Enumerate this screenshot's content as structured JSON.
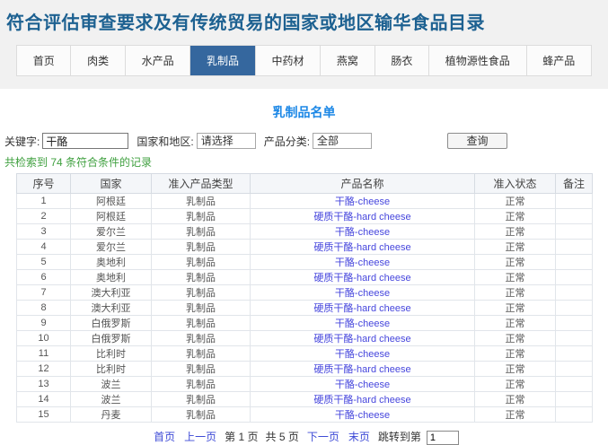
{
  "page": {
    "title": "符合评估审查要求及有传统贸易的国家或地区输华食品目录"
  },
  "nav": {
    "items": [
      {
        "label": "首页",
        "active": false
      },
      {
        "label": "肉类",
        "active": false
      },
      {
        "label": "水产品",
        "active": false
      },
      {
        "label": "乳制品",
        "active": true
      },
      {
        "label": "中药材",
        "active": false
      },
      {
        "label": "燕窝",
        "active": false
      },
      {
        "label": "肠衣",
        "active": false
      },
      {
        "label": "植物源性食品",
        "active": false
      },
      {
        "label": "蜂产品",
        "active": false
      }
    ]
  },
  "section": {
    "title": "乳制品名单"
  },
  "search": {
    "keyword_label": "关键字:",
    "keyword_value": "干酪",
    "country_label": "国家和地区:",
    "country_value": "请选择",
    "category_label": "产品分类:",
    "category_value": "全部",
    "query_button": "查询"
  },
  "result_summary": {
    "text": "共检索到 74 条符合条件的记录",
    "count": "74"
  },
  "table": {
    "headers": [
      "序号",
      "国家",
      "准入产品类型",
      "产品名称",
      "准入状态",
      "备注"
    ],
    "rows": [
      [
        "1",
        "阿根廷",
        "乳制品",
        "干酪-cheese",
        "正常",
        ""
      ],
      [
        "2",
        "阿根廷",
        "乳制品",
        "硬质干酪-hard cheese",
        "正常",
        ""
      ],
      [
        "3",
        "爱尔兰",
        "乳制品",
        "干酪-cheese",
        "正常",
        ""
      ],
      [
        "4",
        "爱尔兰",
        "乳制品",
        "硬质干酪-hard cheese",
        "正常",
        ""
      ],
      [
        "5",
        "奥地利",
        "乳制品",
        "干酪-cheese",
        "正常",
        ""
      ],
      [
        "6",
        "奥地利",
        "乳制品",
        "硬质干酪-hard cheese",
        "正常",
        ""
      ],
      [
        "7",
        "澳大利亚",
        "乳制品",
        "干酪-cheese",
        "正常",
        ""
      ],
      [
        "8",
        "澳大利亚",
        "乳制品",
        "硬质干酪-hard cheese",
        "正常",
        ""
      ],
      [
        "9",
        "白俄罗斯",
        "乳制品",
        "干酪-cheese",
        "正常",
        ""
      ],
      [
        "10",
        "白俄罗斯",
        "乳制品",
        "硬质干酪-hard cheese",
        "正常",
        ""
      ],
      [
        "11",
        "比利时",
        "乳制品",
        "干酪-cheese",
        "正常",
        ""
      ],
      [
        "12",
        "比利时",
        "乳制品",
        "硬质干酪-hard cheese",
        "正常",
        ""
      ],
      [
        "13",
        "波兰",
        "乳制品",
        "干酪-cheese",
        "正常",
        ""
      ],
      [
        "14",
        "波兰",
        "乳制品",
        "硬质干酪-hard cheese",
        "正常",
        ""
      ],
      [
        "15",
        "丹麦",
        "乳制品",
        "干酪-cheese",
        "正常",
        ""
      ]
    ]
  },
  "pagination": {
    "items": [
      {
        "text": "首页",
        "link": true
      },
      {
        "text": "上一页",
        "link": true
      },
      {
        "text": "第 1 页",
        "link": false
      },
      {
        "text": "共 5 页",
        "link": false
      },
      {
        "text": "下一页",
        "link": true
      },
      {
        "text": "末页",
        "link": true
      },
      {
        "text": "跳转到第",
        "link": false
      }
    ],
    "current_page": "1",
    "total_pages": "5",
    "jump_value": "1"
  },
  "colors": {
    "page_title_blue": "#1d6191",
    "active_tab_blue": "#35679e",
    "section_title_blue": "#1b87e6",
    "link_blue": "#4646dd",
    "success_green": "#3fa03f"
  }
}
